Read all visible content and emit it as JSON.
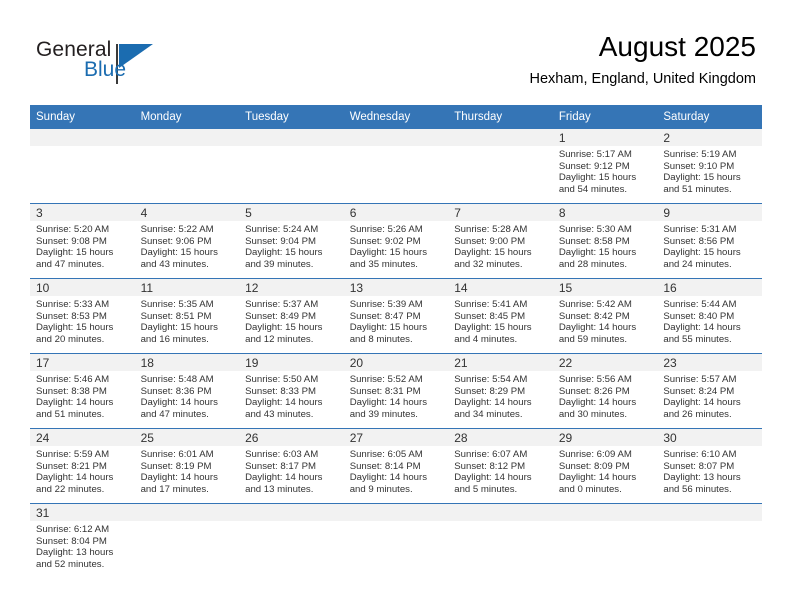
{
  "brand": {
    "name_top": "General",
    "name_bottom": "Blue",
    "color_blue": "#1b6cb0",
    "color_dark": "#231f20",
    "logo_icon": "triangle-flag-icon"
  },
  "header": {
    "title": "August 2025",
    "location": "Hexham, England, United Kingdom"
  },
  "theme": {
    "header_blue": "#3575b6",
    "cell_band_gray": "#f2f2f2",
    "text_dark": "#333333"
  },
  "calendar": {
    "weekday_headers": [
      "Sunday",
      "Monday",
      "Tuesday",
      "Wednesday",
      "Thursday",
      "Friday",
      "Saturday"
    ],
    "weeks": [
      [
        {
          "day": "",
          "sunrise": "",
          "sunset": "",
          "daylight_1": "",
          "daylight_2": ""
        },
        {
          "day": "",
          "sunrise": "",
          "sunset": "",
          "daylight_1": "",
          "daylight_2": ""
        },
        {
          "day": "",
          "sunrise": "",
          "sunset": "",
          "daylight_1": "",
          "daylight_2": ""
        },
        {
          "day": "",
          "sunrise": "",
          "sunset": "",
          "daylight_1": "",
          "daylight_2": ""
        },
        {
          "day": "",
          "sunrise": "",
          "sunset": "",
          "daylight_1": "",
          "daylight_2": ""
        },
        {
          "day": "1",
          "sunrise": "Sunrise: 5:17 AM",
          "sunset": "Sunset: 9:12 PM",
          "daylight_1": "Daylight: 15 hours",
          "daylight_2": "and 54 minutes."
        },
        {
          "day": "2",
          "sunrise": "Sunrise: 5:19 AM",
          "sunset": "Sunset: 9:10 PM",
          "daylight_1": "Daylight: 15 hours",
          "daylight_2": "and 51 minutes."
        }
      ],
      [
        {
          "day": "3",
          "sunrise": "Sunrise: 5:20 AM",
          "sunset": "Sunset: 9:08 PM",
          "daylight_1": "Daylight: 15 hours",
          "daylight_2": "and 47 minutes."
        },
        {
          "day": "4",
          "sunrise": "Sunrise: 5:22 AM",
          "sunset": "Sunset: 9:06 PM",
          "daylight_1": "Daylight: 15 hours",
          "daylight_2": "and 43 minutes."
        },
        {
          "day": "5",
          "sunrise": "Sunrise: 5:24 AM",
          "sunset": "Sunset: 9:04 PM",
          "daylight_1": "Daylight: 15 hours",
          "daylight_2": "and 39 minutes."
        },
        {
          "day": "6",
          "sunrise": "Sunrise: 5:26 AM",
          "sunset": "Sunset: 9:02 PM",
          "daylight_1": "Daylight: 15 hours",
          "daylight_2": "and 35 minutes."
        },
        {
          "day": "7",
          "sunrise": "Sunrise: 5:28 AM",
          "sunset": "Sunset: 9:00 PM",
          "daylight_1": "Daylight: 15 hours",
          "daylight_2": "and 32 minutes."
        },
        {
          "day": "8",
          "sunrise": "Sunrise: 5:30 AM",
          "sunset": "Sunset: 8:58 PM",
          "daylight_1": "Daylight: 15 hours",
          "daylight_2": "and 28 minutes."
        },
        {
          "day": "9",
          "sunrise": "Sunrise: 5:31 AM",
          "sunset": "Sunset: 8:56 PM",
          "daylight_1": "Daylight: 15 hours",
          "daylight_2": "and 24 minutes."
        }
      ],
      [
        {
          "day": "10",
          "sunrise": "Sunrise: 5:33 AM",
          "sunset": "Sunset: 8:53 PM",
          "daylight_1": "Daylight: 15 hours",
          "daylight_2": "and 20 minutes."
        },
        {
          "day": "11",
          "sunrise": "Sunrise: 5:35 AM",
          "sunset": "Sunset: 8:51 PM",
          "daylight_1": "Daylight: 15 hours",
          "daylight_2": "and 16 minutes."
        },
        {
          "day": "12",
          "sunrise": "Sunrise: 5:37 AM",
          "sunset": "Sunset: 8:49 PM",
          "daylight_1": "Daylight: 15 hours",
          "daylight_2": "and 12 minutes."
        },
        {
          "day": "13",
          "sunrise": "Sunrise: 5:39 AM",
          "sunset": "Sunset: 8:47 PM",
          "daylight_1": "Daylight: 15 hours",
          "daylight_2": "and 8 minutes."
        },
        {
          "day": "14",
          "sunrise": "Sunrise: 5:41 AM",
          "sunset": "Sunset: 8:45 PM",
          "daylight_1": "Daylight: 15 hours",
          "daylight_2": "and 4 minutes."
        },
        {
          "day": "15",
          "sunrise": "Sunrise: 5:42 AM",
          "sunset": "Sunset: 8:42 PM",
          "daylight_1": "Daylight: 14 hours",
          "daylight_2": "and 59 minutes."
        },
        {
          "day": "16",
          "sunrise": "Sunrise: 5:44 AM",
          "sunset": "Sunset: 8:40 PM",
          "daylight_1": "Daylight: 14 hours",
          "daylight_2": "and 55 minutes."
        }
      ],
      [
        {
          "day": "17",
          "sunrise": "Sunrise: 5:46 AM",
          "sunset": "Sunset: 8:38 PM",
          "daylight_1": "Daylight: 14 hours",
          "daylight_2": "and 51 minutes."
        },
        {
          "day": "18",
          "sunrise": "Sunrise: 5:48 AM",
          "sunset": "Sunset: 8:36 PM",
          "daylight_1": "Daylight: 14 hours",
          "daylight_2": "and 47 minutes."
        },
        {
          "day": "19",
          "sunrise": "Sunrise: 5:50 AM",
          "sunset": "Sunset: 8:33 PM",
          "daylight_1": "Daylight: 14 hours",
          "daylight_2": "and 43 minutes."
        },
        {
          "day": "20",
          "sunrise": "Sunrise: 5:52 AM",
          "sunset": "Sunset: 8:31 PM",
          "daylight_1": "Daylight: 14 hours",
          "daylight_2": "and 39 minutes."
        },
        {
          "day": "21",
          "sunrise": "Sunrise: 5:54 AM",
          "sunset": "Sunset: 8:29 PM",
          "daylight_1": "Daylight: 14 hours",
          "daylight_2": "and 34 minutes."
        },
        {
          "day": "22",
          "sunrise": "Sunrise: 5:56 AM",
          "sunset": "Sunset: 8:26 PM",
          "daylight_1": "Daylight: 14 hours",
          "daylight_2": "and 30 minutes."
        },
        {
          "day": "23",
          "sunrise": "Sunrise: 5:57 AM",
          "sunset": "Sunset: 8:24 PM",
          "daylight_1": "Daylight: 14 hours",
          "daylight_2": "and 26 minutes."
        }
      ],
      [
        {
          "day": "24",
          "sunrise": "Sunrise: 5:59 AM",
          "sunset": "Sunset: 8:21 PM",
          "daylight_1": "Daylight: 14 hours",
          "daylight_2": "and 22 minutes."
        },
        {
          "day": "25",
          "sunrise": "Sunrise: 6:01 AM",
          "sunset": "Sunset: 8:19 PM",
          "daylight_1": "Daylight: 14 hours",
          "daylight_2": "and 17 minutes."
        },
        {
          "day": "26",
          "sunrise": "Sunrise: 6:03 AM",
          "sunset": "Sunset: 8:17 PM",
          "daylight_1": "Daylight: 14 hours",
          "daylight_2": "and 13 minutes."
        },
        {
          "day": "27",
          "sunrise": "Sunrise: 6:05 AM",
          "sunset": "Sunset: 8:14 PM",
          "daylight_1": "Daylight: 14 hours",
          "daylight_2": "and 9 minutes."
        },
        {
          "day": "28",
          "sunrise": "Sunrise: 6:07 AM",
          "sunset": "Sunset: 8:12 PM",
          "daylight_1": "Daylight: 14 hours",
          "daylight_2": "and 5 minutes."
        },
        {
          "day": "29",
          "sunrise": "Sunrise: 6:09 AM",
          "sunset": "Sunset: 8:09 PM",
          "daylight_1": "Daylight: 14 hours",
          "daylight_2": "and 0 minutes."
        },
        {
          "day": "30",
          "sunrise": "Sunrise: 6:10 AM",
          "sunset": "Sunset: 8:07 PM",
          "daylight_1": "Daylight: 13 hours",
          "daylight_2": "and 56 minutes."
        }
      ],
      [
        {
          "day": "31",
          "sunrise": "Sunrise: 6:12 AM",
          "sunset": "Sunset: 8:04 PM",
          "daylight_1": "Daylight: 13 hours",
          "daylight_2": "and 52 minutes."
        },
        {
          "day": "",
          "sunrise": "",
          "sunset": "",
          "daylight_1": "",
          "daylight_2": ""
        },
        {
          "day": "",
          "sunrise": "",
          "sunset": "",
          "daylight_1": "",
          "daylight_2": ""
        },
        {
          "day": "",
          "sunrise": "",
          "sunset": "",
          "daylight_1": "",
          "daylight_2": ""
        },
        {
          "day": "",
          "sunrise": "",
          "sunset": "",
          "daylight_1": "",
          "daylight_2": ""
        },
        {
          "day": "",
          "sunrise": "",
          "sunset": "",
          "daylight_1": "",
          "daylight_2": ""
        },
        {
          "day": "",
          "sunrise": "",
          "sunset": "",
          "daylight_1": "",
          "daylight_2": ""
        }
      ]
    ]
  }
}
